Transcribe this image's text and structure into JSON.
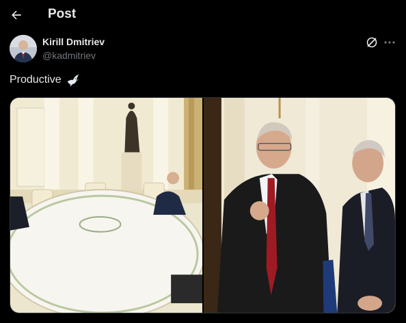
{
  "header": {
    "title": "Post",
    "back_icon": "arrow-left-icon"
  },
  "post": {
    "author_name": "Kirill Dmitriev",
    "author_handle": "@kadmitriev",
    "text": "Productive",
    "emoji_icon": "dove-icon",
    "actions": {
      "grok_icon": "grok-icon",
      "more_icon": "more-dots-icon"
    }
  },
  "media": {
    "count": 2,
    "photos": [
      {
        "name": "meeting-room-photo",
        "content": "photo"
      },
      {
        "name": "two-men-photo",
        "content": "photo"
      }
    ]
  },
  "colors": {
    "background": "#000000",
    "primary_text": "#e7e9ea",
    "secondary_text": "#71767b",
    "border": "#2f3336"
  }
}
